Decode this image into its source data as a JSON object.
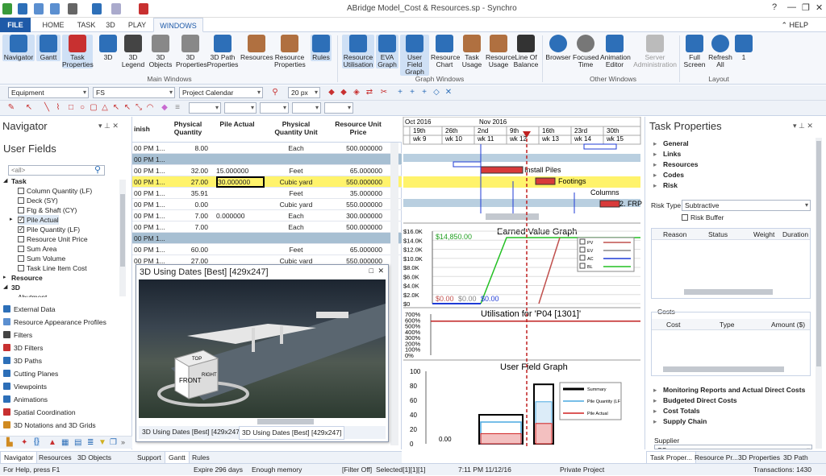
{
  "app": {
    "title": "ABridge Model_Cost & Resources.sp - Synchro",
    "help": "HELP"
  },
  "tabs": [
    "FILE",
    "HOME",
    "TASK",
    "3D",
    "PLAY",
    "WINDOWS"
  ],
  "ribbon": {
    "groups": [
      {
        "label": "Main Windows",
        "buttons": [
          "Navigator",
          "Gantt",
          "Task Properties",
          "3D",
          "3D Legend",
          "3D Objects",
          "3D Properties",
          "3D Path Properties",
          "Resources",
          "Resource Properties",
          "Rules"
        ]
      },
      {
        "label": "Graph Windows",
        "buttons": [
          "Resource Utilisation",
          "EVA Graph",
          "User Field Graph",
          "Resource Chart",
          "Task Usage",
          "Resource Usage",
          "Line Of Balance"
        ]
      },
      {
        "label": "Other Windows",
        "buttons": [
          "Browser",
          "Focused Time",
          "Animation Editor",
          "Server Administration"
        ]
      },
      {
        "label": "Layout",
        "buttons": [
          "Full Screen",
          "Refresh All",
          "1"
        ]
      }
    ]
  },
  "toolbar": {
    "equipment": "Equipment",
    "fs": "FS",
    "calendar": "Project Calendar",
    "px": "20 px"
  },
  "navigator": {
    "title": "Navigator",
    "section": "User Fields",
    "search_placeholder": "<all>",
    "tree": [
      {
        "label": "Task",
        "level": 0,
        "bold": true,
        "exp": "◢"
      },
      {
        "label": "Column Quantity (LF)",
        "level": 1,
        "cb": false
      },
      {
        "label": "Deck (SY)",
        "level": 1,
        "cb": false
      },
      {
        "label": "Ftg & Shaft (CY)",
        "level": 1,
        "cb": false
      },
      {
        "label": "Pile Actual",
        "level": 1,
        "cb": true,
        "exp": "▸"
      },
      {
        "label": "Pile Quantity (LF)",
        "level": 1,
        "cb": true
      },
      {
        "label": "Resource Unit Price",
        "level": 1,
        "cb": false
      },
      {
        "label": "Sum Area",
        "level": 1,
        "cb": false
      },
      {
        "label": "Sum Volume",
        "level": 1,
        "cb": false
      },
      {
        "label": "Task Line Item Cost",
        "level": 1,
        "cb": false
      },
      {
        "label": "Resource",
        "level": 0,
        "bold": true,
        "exp": "▸"
      },
      {
        "label": "3D",
        "level": 0,
        "bold": true,
        "exp": "◢"
      },
      {
        "label": "Abutment",
        "level": 1
      }
    ],
    "links": [
      {
        "label": "External Data",
        "color": "#2d6fb8"
      },
      {
        "label": "Resource Appearance Profiles",
        "color": "#5b8fd0"
      },
      {
        "label": "Filters",
        "color": "#444"
      },
      {
        "label": "3D Filters",
        "color": "#c83030"
      },
      {
        "label": "3D Paths",
        "color": "#2d6fb8"
      },
      {
        "label": "Cutting Planes",
        "color": "#2d6fb8"
      },
      {
        "label": "Viewpoints",
        "color": "#2d6fb8"
      },
      {
        "label": "Animations",
        "color": "#2d6fb8"
      },
      {
        "label": "Spatial Coordination",
        "color": "#c83030"
      },
      {
        "label": "3D Notations and 3D Grids",
        "color": "#d08a20"
      }
    ],
    "bottom_tabs": [
      "Navigator",
      "Resources",
      "3D Objects"
    ]
  },
  "grid": {
    "headers": [
      "inish",
      "Physical Quantity",
      "Pile Actual",
      "Physical Quantity Unit",
      "Resource Unit Price"
    ],
    "rows": [
      {
        "c": [
          "00 PM 1...",
          "8.00",
          "",
          "Each",
          "500.000000"
        ],
        "t": ""
      },
      {
        "c": [
          "00 PM 1...",
          "",
          "",
          "",
          ""
        ],
        "t": "band"
      },
      {
        "c": [
          "00 PM 1...",
          "32.00",
          "15.000000",
          "Feet",
          "65.000000"
        ],
        "t": ""
      },
      {
        "c": [
          "00 PM 1...",
          "27.00",
          "30.000000",
          "Cubic yard",
          "550.000000"
        ],
        "t": "sel"
      },
      {
        "c": [
          "00 PM 1...",
          "35.91",
          "",
          "Feet",
          "35.000000"
        ],
        "t": ""
      },
      {
        "c": [
          "00 PM 1...",
          "0.00",
          "",
          "Cubic yard",
          "550.000000"
        ],
        "t": ""
      },
      {
        "c": [
          "00 PM 1...",
          "7.00",
          "0.000000",
          "Each",
          "300.000000"
        ],
        "t": ""
      },
      {
        "c": [
          "00 PM 1...",
          "7.00",
          "",
          "Each",
          "500.000000"
        ],
        "t": ""
      },
      {
        "c": [
          "00 PM 1...",
          "",
          "",
          "",
          ""
        ],
        "t": "band"
      },
      {
        "c": [
          "00 PM 1...",
          "60.00",
          "",
          "Feet",
          "65.000000"
        ],
        "t": ""
      },
      {
        "c": [
          "00 PM 1...",
          "27.00",
          "",
          "Cubic yard",
          "550.000000"
        ],
        "t": ""
      }
    ],
    "bottom_tabs": [
      "Support",
      "Gantt",
      "Rules"
    ]
  },
  "win3d": {
    "title": "3D Using Dates [Best] [429x247]",
    "cube": {
      "front": "FRONT",
      "top": "TOP",
      "right": "RIGHT"
    },
    "tabs": [
      "3D Using Dates [Best] [429x247]",
      "3D Using Dates [Best] [429x247]"
    ]
  },
  "gantt": {
    "months": [
      "Oct 2016",
      "Nov 2016"
    ],
    "days": [
      "19th",
      "26th",
      "2nd",
      "9th",
      "16th",
      "23rd",
      "30th"
    ],
    "weeks": [
      "wk 9",
      "wk 10",
      "wk 11",
      "wk 12",
      "wk 13",
      "wk 14",
      "wk 15"
    ],
    "labels": [
      "Install Piles",
      "Footings",
      "Columns",
      "2. FRP"
    ]
  },
  "eva": {
    "title": "Earned Value Graph",
    "yticks": [
      "$16.0K",
      "$14.0K",
      "$12.0K",
      "$10.0K",
      "$8.0K",
      "$6.0K",
      "$4.0K",
      "$2.0K",
      "$0"
    ],
    "annotation": "$14,850.00",
    "zero_labels": [
      "$0.00",
      "$0.00",
      "$0.00"
    ],
    "legend": [
      "PV",
      "EV",
      "AC",
      "BL"
    ],
    "colors": {
      "PV": "#c0504d",
      "EV": "#888888",
      "AC": "#1f3bd6",
      "BL": "#22c022"
    }
  },
  "util": {
    "title": "Utilisation for 'P04 [1301]'",
    "yticks": [
      "700%",
      "600%",
      "500%",
      "400%",
      "300%",
      "200%",
      "100%",
      "0%"
    ]
  },
  "ufg": {
    "title": "User Field Graph",
    "yticks": [
      "100",
      "80",
      "60",
      "40",
      "20",
      "0"
    ],
    "zero_label": "0.00",
    "legend": [
      "Summary",
      "Pile Quantity (LF",
      "Pile Actual"
    ]
  },
  "task_props": {
    "title": "Task Properties",
    "sections_top": [
      "General",
      "Links",
      "Resources",
      "Codes",
      "Risk"
    ],
    "risk_type_label": "Risk Type",
    "risk_type_value": "Subtractive",
    "risk_buffer": "Risk Buffer",
    "risk_cols": [
      "Reason",
      "Status",
      "Weight",
      "Duration"
    ],
    "costs_label": "Costs",
    "cost_cols": [
      "Cost",
      "Type",
      "Amount ($)"
    ],
    "sections_bottom": [
      "Monitoring Reports and Actual Direct Costs",
      "Budgeted Direct Costs",
      "Cost Totals",
      "Supply Chain"
    ],
    "supplier_label": "Supplier",
    "supplier_value": "SS",
    "bottom_tabs": [
      "Task Proper...",
      "Resource Pr...",
      "3D Properties",
      "3D Path Edi..."
    ]
  },
  "status": {
    "help": "For Help, press F1",
    "expire": "Expire 296 days",
    "memory": "Enough memory",
    "filter": "[Filter Off]",
    "selected": "Selected[1][1][1]",
    "time": "7:11 PM 11/12/16",
    "project": "Private Project",
    "transactions": "Transactions: 1430"
  }
}
